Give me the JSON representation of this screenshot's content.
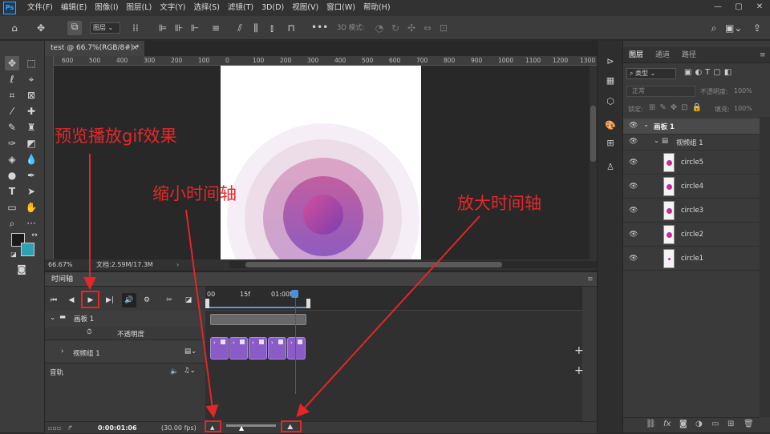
{
  "app": {
    "logo": "Ps"
  },
  "menubar": {
    "items": [
      "文件(F)",
      "编辑(E)",
      "图像(I)",
      "图层(L)",
      "文字(Y)",
      "选择(S)",
      "滤镜(T)",
      "3D(D)",
      "视图(V)",
      "窗口(W)",
      "帮助(H)"
    ],
    "window_controls": [
      "—",
      "▢",
      "✕"
    ]
  },
  "options": {
    "layer_select": "图层",
    "mode_3d": "3D 模式:"
  },
  "document": {
    "tab_title": "test @ 66.7%(RGB/8#) *",
    "close": "×"
  },
  "ruler_h": [
    "600",
    "500",
    "400",
    "300",
    "200",
    "100",
    "0",
    "100",
    "200",
    "300",
    "400",
    "500",
    "600",
    "700",
    "800",
    "900",
    "1000",
    "1100",
    "1200",
    "1300"
  ],
  "status": {
    "zoom": "66.67%",
    "doc_info": "文档:2.59M/17.3M"
  },
  "timeline": {
    "title": "时间轴",
    "ruler_labels": [
      "00",
      "15f",
      "01:00f"
    ],
    "artboard_label": "画板 1",
    "opacity_label": "不透明度",
    "video_group_label": "视频组 1",
    "audio_label": "音轨",
    "current_time": "0:00:01:06",
    "fps": "(30.00 fps)",
    "add_btn": "+"
  },
  "layers_panel": {
    "tabs": [
      "图层",
      "通道",
      "路径"
    ],
    "filter_kind": "类型",
    "blend_mode": "正常",
    "opacity_label": "不透明度:",
    "opacity_value": "100%",
    "lock_label": "锁定:",
    "fill_label": "填充:",
    "fill_value": "100%",
    "rows": [
      {
        "name": "画板 1"
      },
      {
        "name": "视频组 1"
      },
      {
        "name": "circle5"
      },
      {
        "name": "circle4"
      },
      {
        "name": "circle3"
      },
      {
        "name": "circle2"
      },
      {
        "name": "circle1"
      }
    ]
  },
  "annotations": {
    "preview": "预览播放gif效果",
    "zoom_out": "缩小时间轴",
    "zoom_in": "放大时间轴"
  },
  "colors": {
    "accent": "#31a8ff",
    "annotation_red": "#e8272a",
    "clip_purple": "#8b5cc8"
  }
}
